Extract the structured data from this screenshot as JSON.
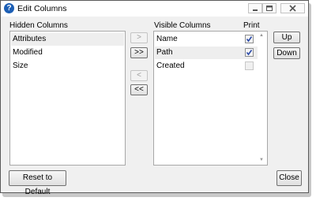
{
  "window": {
    "title": "Edit Columns",
    "icon": "help-icon",
    "controls": [
      "minimize-icon",
      "restore-icon",
      "close-icon"
    ]
  },
  "hidden": {
    "header": "Hidden Columns",
    "items": [
      {
        "label": "Attributes",
        "selected": true
      },
      {
        "label": "Modified",
        "selected": false
      },
      {
        "label": "Size",
        "selected": false
      }
    ]
  },
  "visible": {
    "header": "Visible Columns",
    "print_header": "Print",
    "items": [
      {
        "label": "Name",
        "print": true
      },
      {
        "label": "Path",
        "print": true
      },
      {
        "label": "Created",
        "print": false
      }
    ]
  },
  "transfer": {
    "add_one": ">",
    "add_all": ">>",
    "remove_one": "<",
    "remove_all": "<<"
  },
  "order": {
    "up": "Up",
    "down": "Down"
  },
  "footer": {
    "reset": "Reset to Default",
    "close": "Close"
  },
  "colors": {
    "accent": "#1d5fb5",
    "check": "#2b4aa8",
    "border": "#a8a8a8"
  }
}
